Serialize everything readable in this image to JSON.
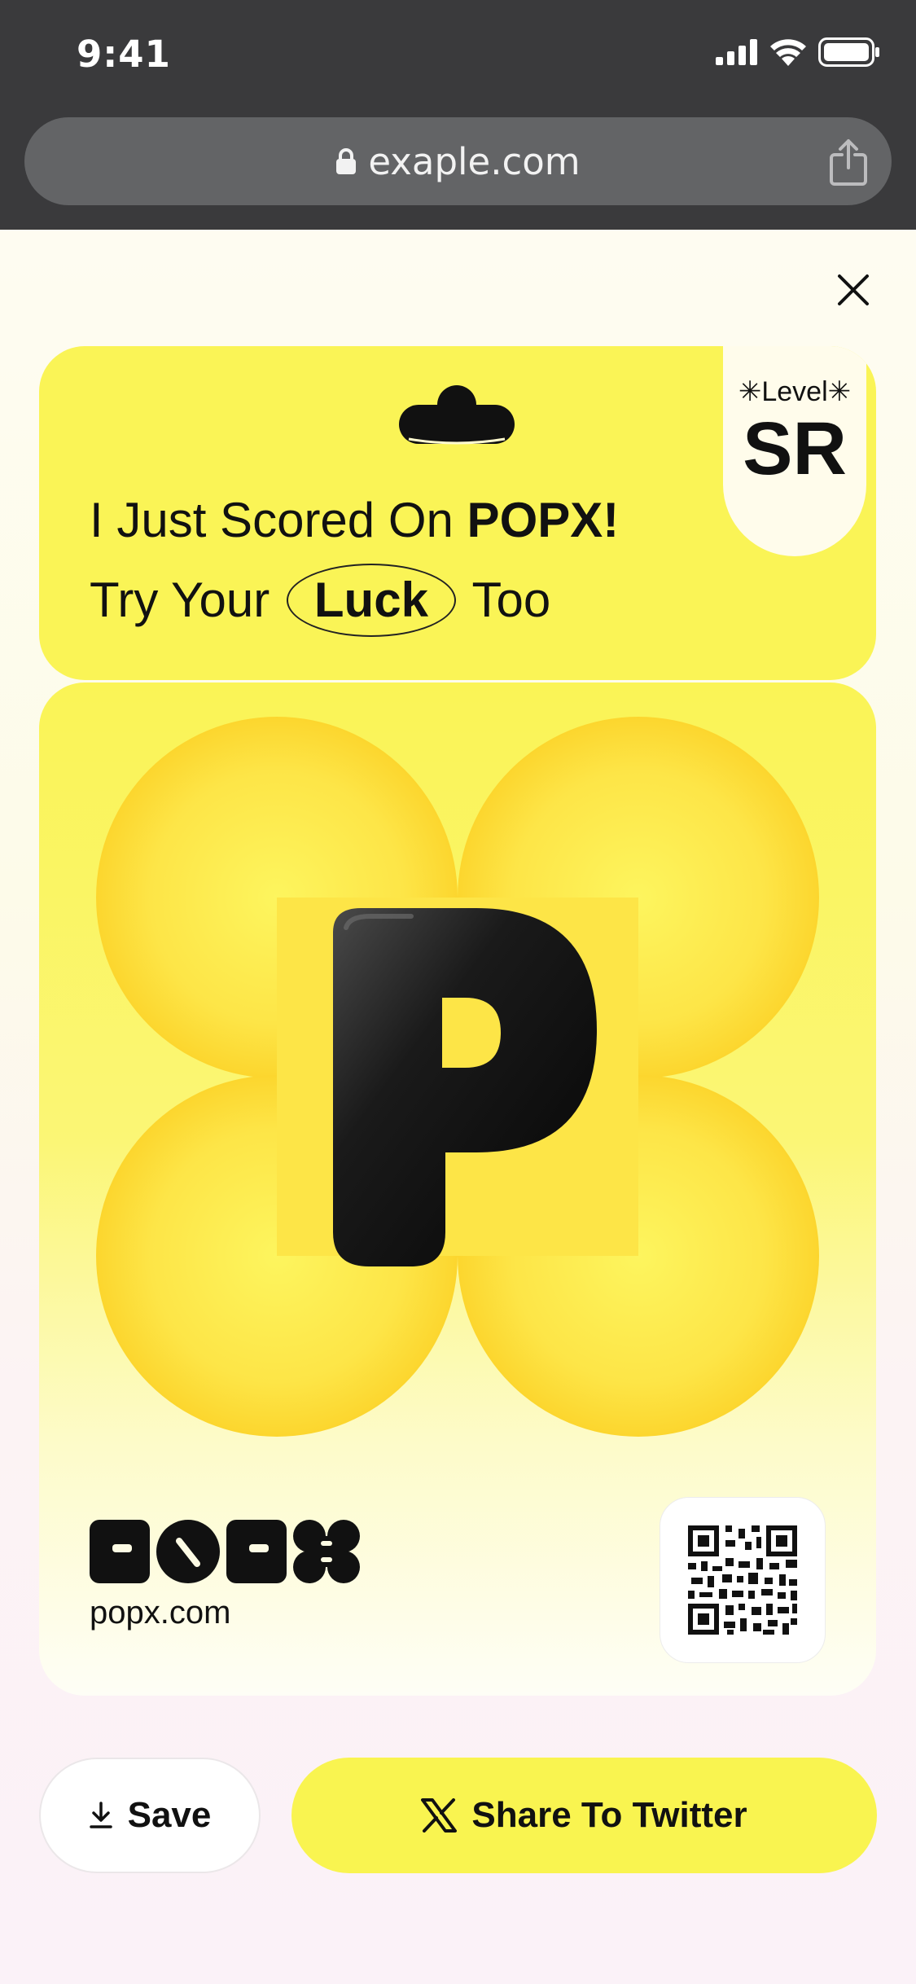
{
  "status_bar": {
    "time": "9:41"
  },
  "browser": {
    "url": "exaple.com"
  },
  "card": {
    "headline_prefix": "I Just Scored On ",
    "headline_brand": "POPX!",
    "line2_prefix": "Try Your",
    "line2_highlight": "Luck",
    "line2_suffix": "Too",
    "level_label": "✳Level✳",
    "level_value": "SR",
    "prize_letter": "P",
    "brand_logo": "POPX",
    "brand_url": "popx.com"
  },
  "actions": {
    "save_label": "Save",
    "share_label": "Share To Twitter"
  },
  "colors": {
    "card_yellow": "#faf456",
    "button_yellow": "#f9f450",
    "chrome_dark": "#3a3a3c"
  },
  "icons": [
    "lock-icon",
    "share-icon",
    "close-icon",
    "download-icon",
    "x-logo-icon",
    "qr-code"
  ]
}
